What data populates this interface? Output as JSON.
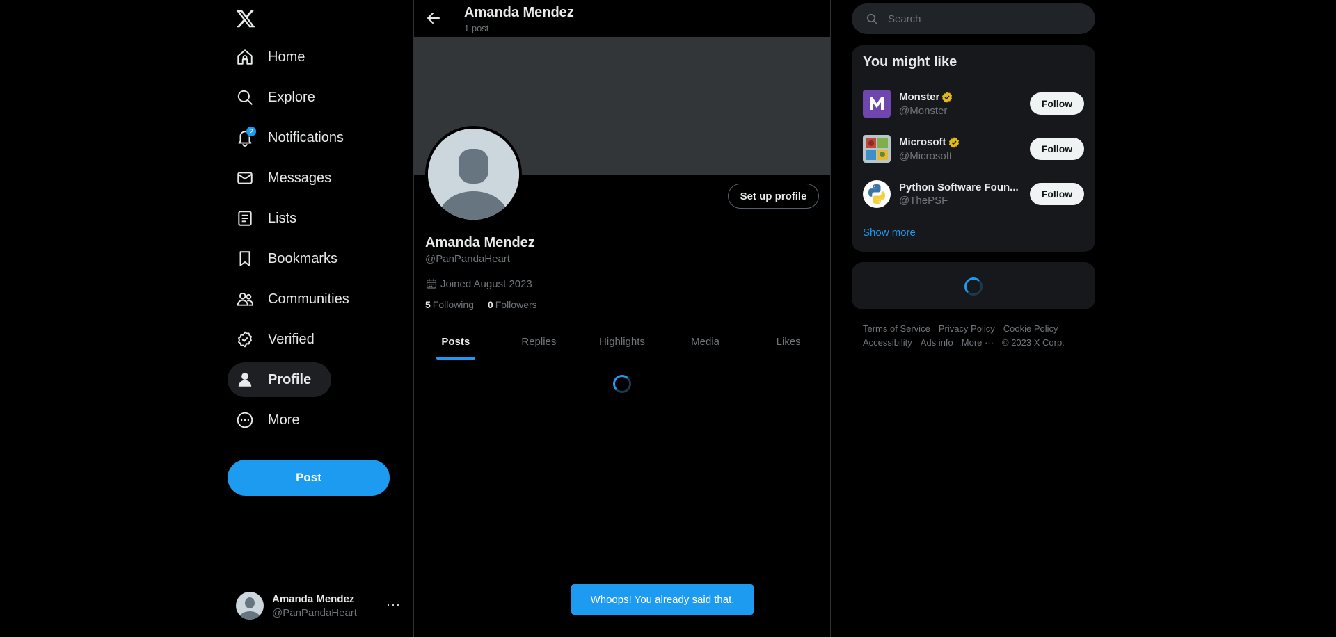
{
  "nav": {
    "items": [
      {
        "label": "Home",
        "icon": "home-icon"
      },
      {
        "label": "Explore",
        "icon": "search-icon"
      },
      {
        "label": "Notifications",
        "icon": "bell-icon",
        "badge": "2"
      },
      {
        "label": "Messages",
        "icon": "envelope-icon"
      },
      {
        "label": "Lists",
        "icon": "list-icon"
      },
      {
        "label": "Bookmarks",
        "icon": "bookmark-icon"
      },
      {
        "label": "Communities",
        "icon": "people-icon"
      },
      {
        "label": "Verified",
        "icon": "verified-icon"
      },
      {
        "label": "Profile",
        "icon": "person-icon",
        "active": true
      },
      {
        "label": "More",
        "icon": "more-circle-icon"
      }
    ],
    "post_label": "Post"
  },
  "account": {
    "name": "Amanda Mendez",
    "handle": "@PanPandaHeart"
  },
  "header": {
    "name": "Amanda Mendez",
    "post_count": "1 post"
  },
  "profile": {
    "setup_label": "Set up profile",
    "name": "Amanda Mendez",
    "handle": "@PanPandaHeart",
    "joined": "Joined August 2023",
    "following_count": "5",
    "following_label": "Following",
    "followers_count": "0",
    "followers_label": "Followers"
  },
  "tabs": [
    "Posts",
    "Replies",
    "Highlights",
    "Media",
    "Likes"
  ],
  "toast": "Whoops! You already said that.",
  "search": {
    "placeholder": "Search"
  },
  "who_to_follow": {
    "title": "You might like",
    "items": [
      {
        "name": "Monster",
        "handle": "@Monster",
        "verified": true,
        "button": "Follow"
      },
      {
        "name": "Microsoft",
        "handle": "@Microsoft",
        "verified": true,
        "button": "Follow"
      },
      {
        "name": "Python Software Foun...",
        "handle": "@ThePSF",
        "verified": false,
        "button": "Follow"
      }
    ],
    "show_more": "Show more"
  },
  "footer": {
    "links": [
      "Terms of Service",
      "Privacy Policy",
      "Cookie Policy",
      "Accessibility",
      "Ads info",
      "More ···"
    ],
    "copyright": "© 2023 X Corp."
  },
  "colors": {
    "accent": "#1d9bf0",
    "background": "#000000",
    "card": "#16181c",
    "verified_gold": "#e2b719"
  }
}
